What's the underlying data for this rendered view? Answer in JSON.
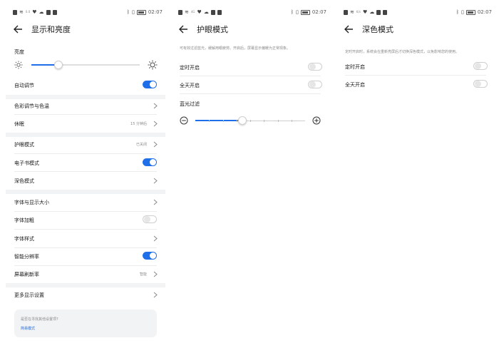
{
  "status_bar": {
    "time": "02:07",
    "net_1": "4G",
    "net_2": "0.0",
    "net_3": "K/s"
  },
  "panel1": {
    "title": "显示和亮度",
    "brightness_label": "亮度",
    "brightness_level": 0.25,
    "items": {
      "auto_adjust": {
        "label": "自动调节",
        "toggle": "on"
      },
      "color_temp": {
        "label": "色彩调节与色温"
      },
      "sleep": {
        "label": "休眠",
        "value": "15 分钟后"
      },
      "eye_comfort": {
        "label": "护眼模式",
        "value": "已关闭"
      },
      "ebook": {
        "label": "电子书模式",
        "toggle": "on"
      },
      "dark": {
        "label": "深色模式"
      },
      "font_size": {
        "label": "字体与显示大小"
      },
      "bold": {
        "label": "字体加粗",
        "toggle": "off"
      },
      "font_style": {
        "label": "字体样式"
      },
      "smart_res": {
        "label": "智能分辨率",
        "toggle": "on"
      },
      "refresh": {
        "label": "屏幕刷新率",
        "value": "智能"
      },
      "more": {
        "label": "更多显示设置"
      }
    },
    "hint": {
      "question": "是否在寻找其他设置项?",
      "link": "简易模式"
    }
  },
  "panel2": {
    "title": "护眼模式",
    "description": "可有效过滤蓝光，缓解用眼疲劳。开启后，屏幕显示偏暖为正常现象。",
    "scheduled": {
      "label": "定时开启",
      "toggle": "off"
    },
    "all_day": {
      "label": "全天开启",
      "toggle": "off"
    },
    "filter_label": "蓝光过滤",
    "filter_level": 0.43
  },
  "panel3": {
    "title": "深色模式",
    "description": "定时开启时，系统会在重新亮屏后才切换深色模式，以免影响您的使用。",
    "scheduled": {
      "label": "定时开启",
      "toggle": "off"
    },
    "all_day": {
      "label": "全天开启",
      "toggle": "off"
    }
  },
  "colors": {
    "accent": "#1e6fe8",
    "divider_band": "#f1f3f5",
    "secondary_text": "#8a8a8a"
  }
}
